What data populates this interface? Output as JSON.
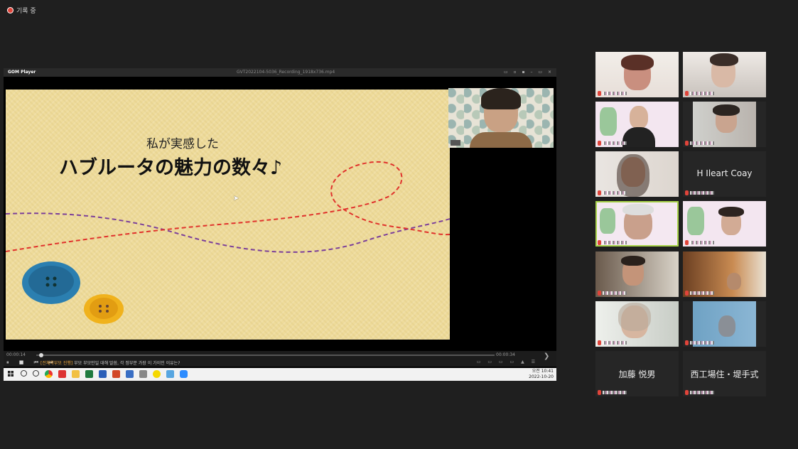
{
  "recording": {
    "label": "기록 중"
  },
  "player": {
    "brand": "GOM Player",
    "filename": "GVT2022104-5036_Recording_1918x736.mp4",
    "window_buttons": "▭ ▫ ▪ – ▭ ×",
    "time_current": "00:00:14",
    "time_total": "00:00:34",
    "subtitle_highlight": "[전체학부모 진행]",
    "subtitle_text": "부모 부모만일 대해 말씀, 각 정부분 가장 이 가이인 이유는?",
    "play_buttons": "⏸ ■ ⏮ ⏭"
  },
  "slide": {
    "subtitle": "私が実感した",
    "title": "ハブルータの魅力の数々♪",
    "colors": {
      "background": "#eedb9a",
      "thread_red": "#e0322c",
      "thread_purple": "#7b3f9a",
      "button_blue": "#2b7fb0",
      "button_yellow": "#f0b21c"
    }
  },
  "taskbar": {
    "time": "오전 10:41",
    "date": "2022-10-20"
  },
  "participants": [
    {
      "id": "p1",
      "label": "",
      "video": true
    },
    {
      "id": "p2",
      "label": "",
      "video": true
    },
    {
      "id": "p3",
      "label": "",
      "video": true
    },
    {
      "id": "p4",
      "label": "",
      "video": true
    },
    {
      "id": "p5",
      "label": "",
      "video": true
    },
    {
      "id": "p6",
      "label": "H Ileart Coay",
      "video": false
    },
    {
      "id": "p7",
      "label": "",
      "video": true,
      "active": true
    },
    {
      "id": "p8",
      "label": "",
      "video": true
    },
    {
      "id": "p9",
      "label": "",
      "video": true
    },
    {
      "id": "p10",
      "label": "",
      "video": true
    },
    {
      "id": "p11",
      "label": "",
      "video": true
    },
    {
      "id": "p12",
      "label": "",
      "video": true
    },
    {
      "id": "p13",
      "label": "加藤 悦男",
      "video": false
    },
    {
      "id": "p14",
      "label": "西工場住・堤手式",
      "video": false
    }
  ]
}
